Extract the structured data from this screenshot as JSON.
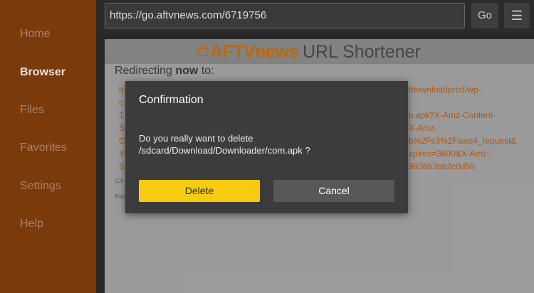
{
  "sidebar": {
    "items": [
      {
        "label": "Home",
        "active": false
      },
      {
        "label": "Browser",
        "active": true
      },
      {
        "label": "Files",
        "active": false
      },
      {
        "label": "Favorites",
        "active": false
      },
      {
        "label": "Settings",
        "active": false
      },
      {
        "label": "Help",
        "active": false
      }
    ]
  },
  "topbar": {
    "url": "https://go.aftvnews.com/6719756",
    "go_label": "Go",
    "menu_icon": "menu-icon"
  },
  "page": {
    "logo_brand": "AFTVnews",
    "logo_title": "URL Shortener",
    "redirecting_prefix": "Redirecting ",
    "redirecting_bold": "now",
    "redirecting_suffix": " to:",
    "link_fragments": [
      "h",
      "c",
      "1",
      "S",
      "C",
      "X",
      "S",
      "/downloadprod/wp-",
      "n.apk?X-Amz-Content-",
      "X-Amz-",
      "b%2Fs3%2Faws4_request&",
      "xpires=3600&X-Amz-",
      "9836b3bb2c0d50"
    ],
    "small_text": [
      "(Cli",
      "Red"
    ]
  },
  "dialog": {
    "title": "Confirmation",
    "message": "Do you really want to delete /sdcard/Download/Downloader/com.apk ?",
    "delete_label": "Delete",
    "cancel_label": "Cancel"
  },
  "colors": {
    "sidebar_bg": "#7a3a0c",
    "accent_yellow": "#f7cb10",
    "link_orange": "#b85a14",
    "brand_orange": "#c46e10"
  }
}
